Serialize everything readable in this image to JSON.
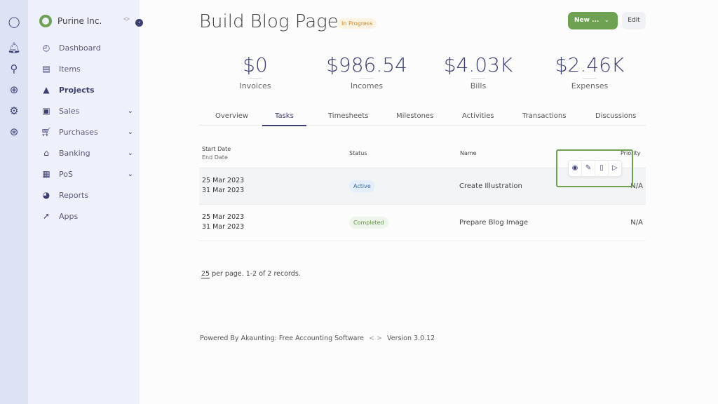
{
  "company": "Purine Inc.",
  "sidebar": {
    "items": [
      {
        "label": "Dashboard",
        "icon": "gauge-icon"
      },
      {
        "label": "Items",
        "icon": "archive-icon"
      },
      {
        "label": "Projects",
        "icon": "flask-icon"
      },
      {
        "label": "Sales",
        "icon": "money-icon"
      },
      {
        "label": "Purchases",
        "icon": "cart-icon"
      },
      {
        "label": "Banking",
        "icon": "bank-icon"
      },
      {
        "label": "PoS",
        "icon": "register-icon"
      },
      {
        "label": "Reports",
        "icon": "chart-pie-icon"
      },
      {
        "label": "Apps",
        "icon": "rocket-icon"
      }
    ]
  },
  "header": {
    "title": "Build Blog Page",
    "status": "In Progress",
    "new_label": "New ...",
    "edit_label": "Edit"
  },
  "stats": [
    {
      "value": "$0",
      "label": "Invoices"
    },
    {
      "value": "$986.54",
      "label": "Incomes"
    },
    {
      "value": "$4.03K",
      "label": "Bills"
    },
    {
      "value": "$2.46K",
      "label": "Expenses"
    }
  ],
  "tabs": [
    "Overview",
    "Tasks",
    "Timesheets",
    "Milestones",
    "Activities",
    "Transactions",
    "Discussions"
  ],
  "table": {
    "headers": {
      "start": "Start Date",
      "end": "End Date",
      "status": "Status",
      "name": "Name",
      "priority": "Priority"
    },
    "rows": [
      {
        "start": "25 Mar 2023",
        "end": "31 Mar 2023",
        "status": "Active",
        "name": "Create Illustration",
        "priority": "N/A"
      },
      {
        "start": "25 Mar 2023",
        "end": "31 Mar 2023",
        "status": "Completed",
        "name": "Prepare Blog Image",
        "priority": "N/A"
      }
    ]
  },
  "pager": {
    "per_page": "25",
    "text": "per page. 1-2 of 2 records."
  },
  "footer": {
    "powered": "Powered By Akaunting: Free Accounting Software",
    "version": "Version 3.0.12"
  },
  "colors": {
    "accent": "#3c3f72",
    "green": "#6ea152"
  }
}
